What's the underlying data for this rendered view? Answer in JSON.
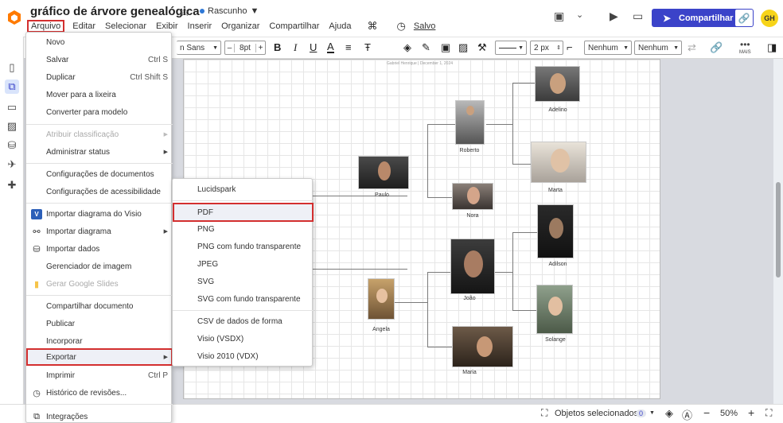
{
  "doc": {
    "title": "gráfico de árvore genealógica",
    "status": "Rascunho"
  },
  "menubar": {
    "items": [
      "Arquivo",
      "Editar",
      "Selecionar",
      "Exibir",
      "Inserir",
      "Organizar",
      "Compartilhar",
      "Ajuda"
    ],
    "saved": "Salvo"
  },
  "share": {
    "label": "Compartilhar"
  },
  "avatar": {
    "initials": "GH"
  },
  "toolbar": {
    "font": "n Sans",
    "font_size": "8pt",
    "font_minus": "–",
    "font_plus": "+",
    "line_width": "2 px",
    "arrow_start": "Nenhum",
    "arrow_end": "Nenhum",
    "more": "MAIS"
  },
  "file_menu": {
    "items": [
      {
        "label": "Novo"
      },
      {
        "label": "Salvar",
        "shortcut": "Ctrl S"
      },
      {
        "label": "Duplicar",
        "shortcut": "Ctrl Shift S"
      },
      {
        "label": "Mover para a lixeira"
      },
      {
        "label": "Converter para modelo"
      },
      {
        "label": "Atribuir classificação",
        "disabled": true,
        "submenu": true
      },
      {
        "label": "Administrar status",
        "submenu": true
      },
      {
        "label": "Configurações de documentos"
      },
      {
        "label": "Configurações de acessibilidade"
      },
      {
        "label": "Importar diagrama do Visio",
        "icon": "visio-icon"
      },
      {
        "label": "Importar diagrama",
        "icon": "import-diagram-icon",
        "submenu": true
      },
      {
        "label": "Importar dados",
        "icon": "database-icon"
      },
      {
        "label": "Gerenciador de imagem"
      },
      {
        "label": "Gerar Google Slides",
        "icon": "google-slides-icon",
        "disabled": true
      },
      {
        "label": "Compartilhar documento"
      },
      {
        "label": "Publicar"
      },
      {
        "label": "Incorporar"
      },
      {
        "label": "Exportar",
        "submenu": true,
        "highlighted": true
      },
      {
        "label": "Imprimir",
        "shortcut": "Ctrl P"
      },
      {
        "label": "Histórico de revisões...",
        "icon": "history-icon"
      },
      {
        "label": "Integrações",
        "icon": "integrations-icon"
      }
    ]
  },
  "export_menu": {
    "items": [
      {
        "label": "Lucidspark"
      },
      {
        "label": "PDF",
        "highlighted": true
      },
      {
        "label": "PNG"
      },
      {
        "label": "PNG com fundo transparente"
      },
      {
        "label": "JPEG"
      },
      {
        "label": "SVG"
      },
      {
        "label": "SVG com fundo transparente"
      },
      {
        "label": "CSV de dados de forma"
      },
      {
        "label": "Visio (VSDX)"
      },
      {
        "label": "Visio 2010 (VDX)"
      }
    ]
  },
  "tree": {
    "header": "Gabriel Henrique | December 1, 2024",
    "people": [
      "Adelino",
      "Roberto",
      "Marta",
      "Paulo",
      "Nora",
      "Adilson",
      "João",
      "Angela",
      "Solange",
      "Maria"
    ]
  },
  "bottombar": {
    "selected_label": "Objetos selecionados",
    "selected_count": "0",
    "zoom": "50%"
  }
}
